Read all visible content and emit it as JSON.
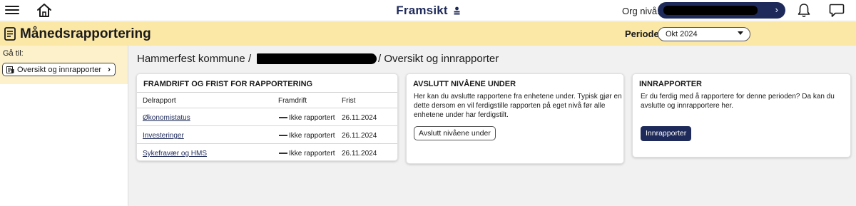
{
  "topbar": {
    "brand": "Framsikt",
    "org_label": "Org nivå:"
  },
  "header": {
    "title": "Månedsrapportering",
    "periode_label": "Periode:",
    "periode_value": "Okt 2024"
  },
  "sidebar": {
    "goto_label": "Gå til:",
    "items": [
      {
        "label": "Oversikt og innrapporter"
      }
    ]
  },
  "breadcrumb": {
    "root": "Hammerfest kommune",
    "separator": "/",
    "current": "/ Oversikt og innrapporter"
  },
  "progress_card": {
    "title": "FRAMDRIFT OG FRIST FOR RAPPORTERING",
    "columns": [
      "Delrapport",
      "Framdrift",
      "Frist"
    ],
    "rows": [
      {
        "name": "Økonomistatus",
        "status": "Ikke rapportert",
        "deadline": "26.11.2024"
      },
      {
        "name": "Investeringer",
        "status": "Ikke rapportert",
        "deadline": "26.11.2024"
      },
      {
        "name": "Sykefravær og HMS",
        "status": "Ikke rapportert",
        "deadline": "26.11.2024"
      }
    ]
  },
  "close_levels_card": {
    "title": "AVSLUTT NIVÅENE UNDER",
    "text_lines": [
      "Her kan du avslutte rapportene fra enhetene under. Typisk gjør en",
      "dette dersom en vil ferdigstille rapporten på eget nivå før alle",
      "enhetene under har ferdigstilt."
    ],
    "button": "Avslutt nivåene under"
  },
  "report_card": {
    "title": "INNRAPPORTER",
    "text_lines": [
      "Er du ferdig med å rapportere for denne perioden? Da kan du",
      "avslutte og innrapportere her."
    ],
    "button": "Innrapporter"
  },
  "icons": {
    "menu": "hamburger-menu-icon",
    "home": "home-icon",
    "brand": "person-icon",
    "org_chevron": "chevron-right-icon",
    "notifications": "bell-icon",
    "chat": "chat-bubble-icon",
    "page": "report-document-icon",
    "periode_caret": "caret-down-icon",
    "sidebar_item": "report-list-icon",
    "sidebar_chevron": "chevron-right-icon"
  },
  "colors": {
    "primary": "#1e2a5a",
    "header_bg": "#fbe7a6",
    "sidebar_highlight": "#fdf1cc",
    "page_bg": "#f1f1f1"
  }
}
